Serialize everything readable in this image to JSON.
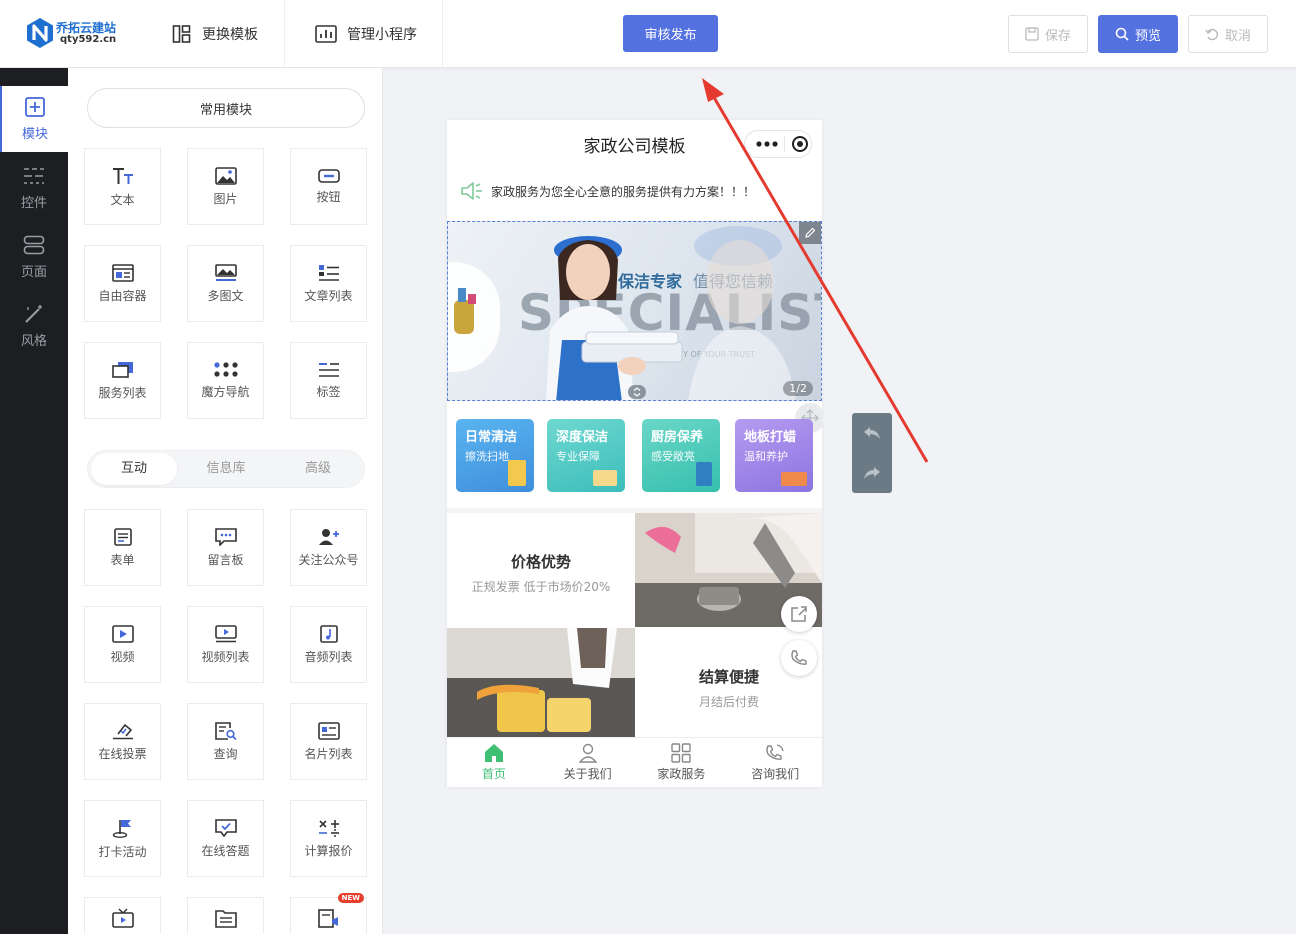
{
  "header": {
    "logo_name": "乔拓云建站",
    "logo_url": "qty592.cn",
    "change_template": "更换模板",
    "manage_miniprogram": "管理小程序",
    "publish": "审核发布",
    "save": "保存",
    "preview": "预览",
    "cancel": "取消"
  },
  "sidebar": {
    "items": [
      {
        "label": "模块",
        "icon": "plus-square-icon"
      },
      {
        "label": "控件",
        "icon": "sliders-icon"
      },
      {
        "label": "页面",
        "icon": "pages-icon"
      },
      {
        "label": "风格",
        "icon": "magic-wand-icon"
      }
    ]
  },
  "panel": {
    "common_label": "常用模块",
    "common_modules": [
      "文本",
      "图片",
      "按钮",
      "自由容器",
      "多图文",
      "文章列表",
      "服务列表",
      "魔方导航",
      "标签"
    ],
    "segments": [
      "互动",
      "信息库",
      "高级"
    ],
    "interactive_modules": [
      "表单",
      "留言板",
      "关注公众号",
      "视频",
      "视频列表",
      "音频列表",
      "在线投票",
      "查询",
      "名片列表",
      "打卡活动",
      "在线答题",
      "计算报价"
    ],
    "new_badge": "NEW"
  },
  "phone": {
    "title": "家政公司模板",
    "notice": "家政服务为您全心全意的服务提供有力方案！！！",
    "banner": {
      "slogan_a": "保洁专家",
      "slogan_b": "值得您信赖",
      "big_word": "SPECIALIST",
      "small_word": "WORTHY OF YOUR TRUST",
      "counter": "1/2"
    },
    "cards": [
      {
        "title": "日常清洁",
        "sub": "擦洗扫地",
        "color": "#4aa6e8"
      },
      {
        "title": "深度保洁",
        "sub": "专业保障",
        "color": "#3cc6c2"
      },
      {
        "title": "厨房保养",
        "sub": "感受敞亮",
        "color": "#36c7b8"
      },
      {
        "title": "地板打蜡",
        "sub": "温和养护",
        "color": "#9b86e8"
      }
    ],
    "grid": {
      "price_title": "价格优势",
      "price_sub": "正规发票 低于市场价20%",
      "settle_title": "结算便捷",
      "settle_sub": "月结后付费"
    },
    "tabs": [
      "首页",
      "关于我们",
      "家政服务",
      "咨询我们"
    ]
  },
  "colors": {
    "brand": "#5471e0",
    "active_tab": "#3fbf74"
  }
}
